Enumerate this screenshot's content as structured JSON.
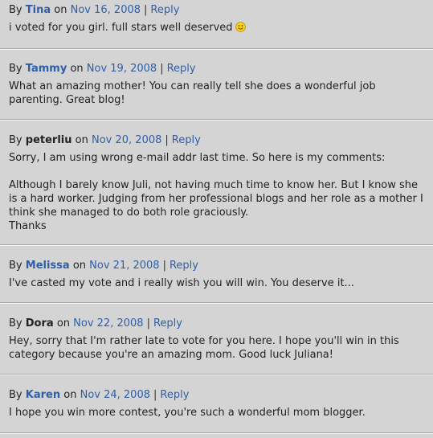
{
  "comments": [
    {
      "by_label": "By",
      "author": "Tina",
      "on_label": "on",
      "date": "Nov 16, 2008",
      "reply": "Reply",
      "paragraphs": [
        "i voted for you girl. full stars well deserved"
      ],
      "emoticon": "smiley-face-icon"
    },
    {
      "by_label": "By",
      "author": "Tammy",
      "on_label": "on",
      "date": "Nov 19, 2008",
      "reply": "Reply",
      "paragraphs": [
        "What an amazing mother! You can really tell she does a wonderful job parenting. Great blog!"
      ]
    },
    {
      "by_label": "By",
      "author": "peterliu",
      "on_label": "on",
      "date": "Nov 20, 2008",
      "reply": "Reply",
      "paragraphs": [
        "Sorry, I am using wrong e-mail addr last time. So here is my comments:",
        "Although I barely know Juli, not having much time to know her. But I know she is a hard worker. Judging from her professional blogs and her role as a mother I think she managed to do both role graciously.",
        "Thanks"
      ]
    },
    {
      "by_label": "By",
      "author": "Melissa",
      "on_label": "on",
      "date": "Nov 21, 2008",
      "reply": "Reply",
      "paragraphs": [
        "I've casted my vote and i really wish you will win. You deserve it..."
      ]
    },
    {
      "by_label": "By",
      "author": "Dora",
      "on_label": "on",
      "date": "Nov 22, 2008",
      "reply": "Reply",
      "paragraphs": [
        "Hey, sorry that I'm rather late to vote for you here. I hope you'll win in this category because you're an amazing mom. Good luck Juliana!"
      ]
    },
    {
      "by_label": "By",
      "author": "Karen",
      "on_label": "on",
      "date": "Nov 24, 2008",
      "reply": "Reply",
      "paragraphs": [
        "I hope you win more contest, you're such a wonderful mom blogger."
      ]
    }
  ]
}
